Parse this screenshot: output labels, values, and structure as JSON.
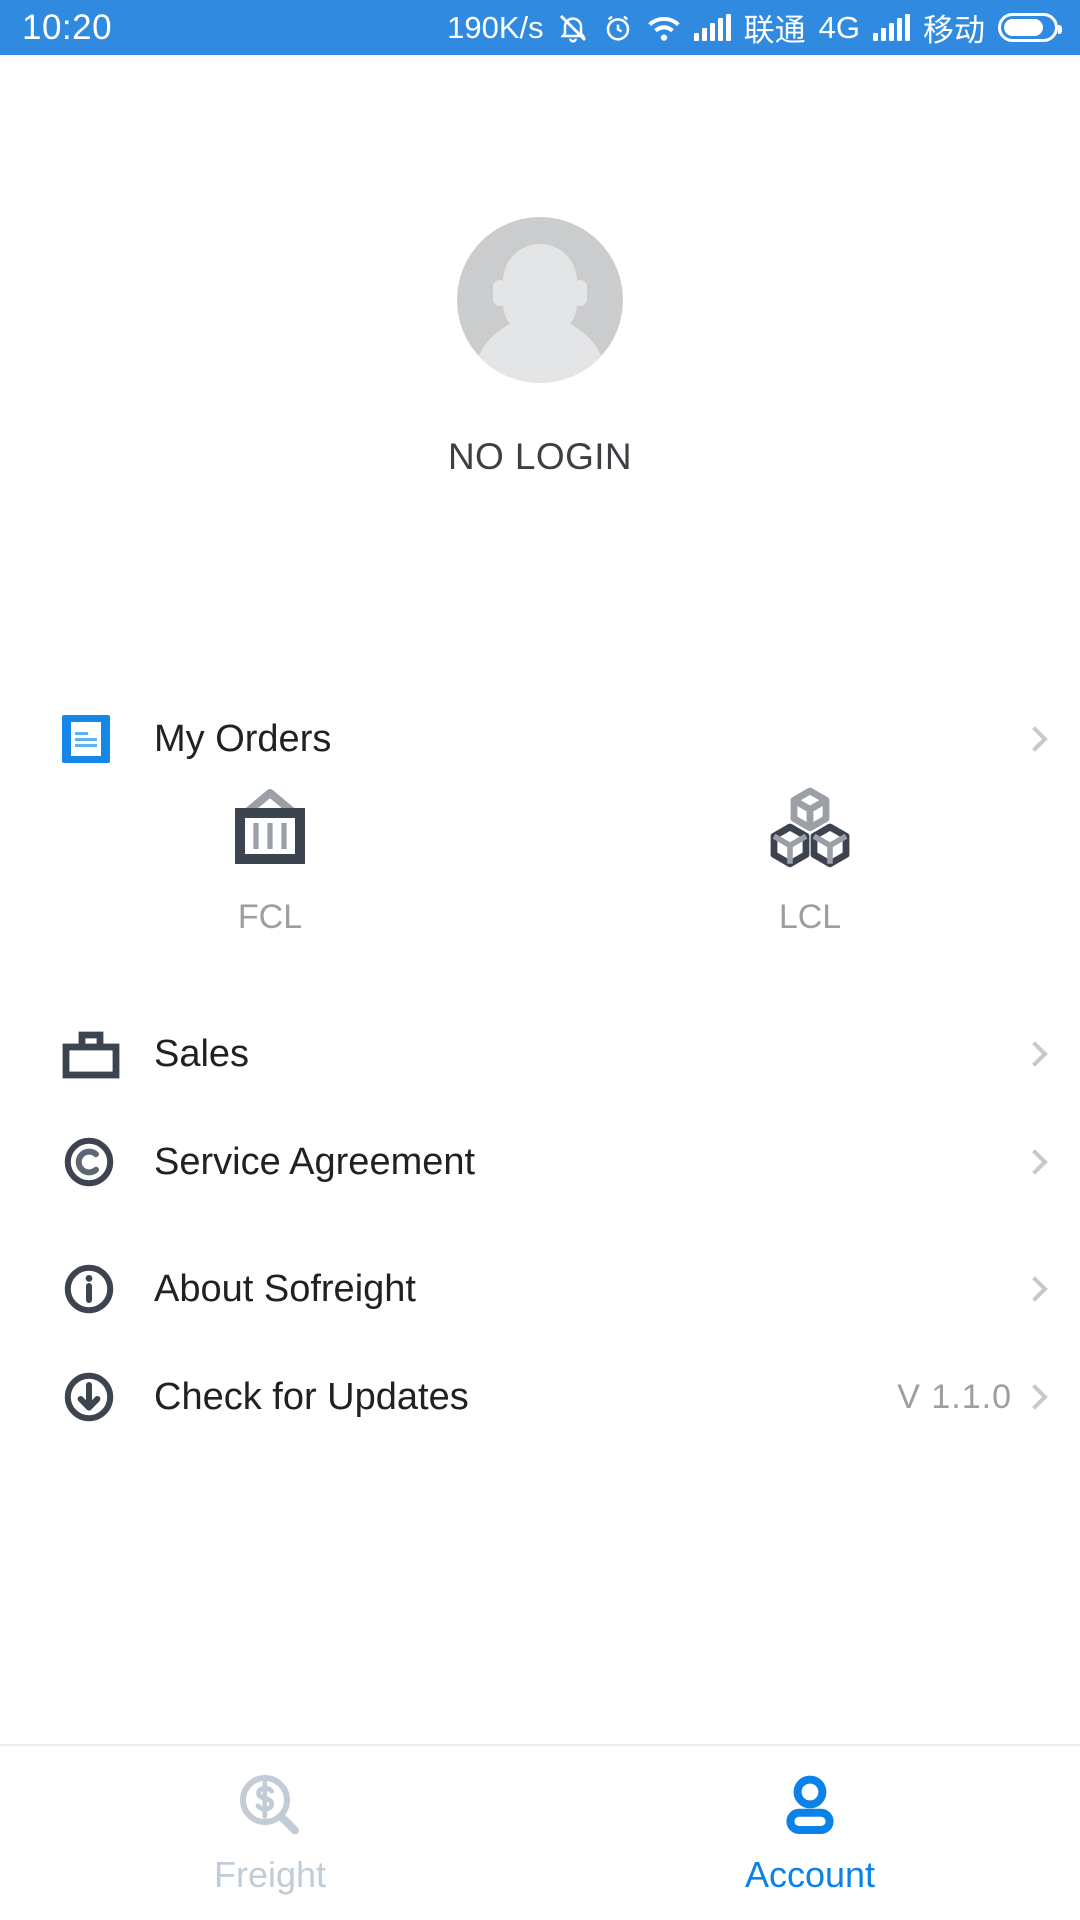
{
  "status_bar": {
    "time": "10:20",
    "net_speed": "190K/s",
    "carrier_1": "联通",
    "network_type": "4G",
    "carrier_2": "移动",
    "icons": [
      "mute-bell-icon",
      "alarm-clock-icon",
      "wifi-icon",
      "signal-bars-icon",
      "signal-bars-icon",
      "battery-icon"
    ],
    "background_color": "#2f8ae0"
  },
  "profile": {
    "avatar_icon": "default-user-avatar",
    "login_status": "NO LOGIN"
  },
  "menu": {
    "orders": {
      "label": "My Orders",
      "icon": "document-list-icon",
      "icon_color": "#1587e8"
    },
    "shipping_modes": [
      {
        "label": "FCL",
        "icon": "shipping-container-icon"
      },
      {
        "label": "LCL",
        "icon": "cubes-stack-icon"
      }
    ],
    "items": [
      {
        "label": "Sales",
        "icon": "briefcase-icon",
        "value": ""
      },
      {
        "label": "Service Agreement",
        "icon": "copyright-circle-icon",
        "value": ""
      },
      {
        "label": "About Sofreight",
        "icon": "info-circle-icon",
        "value": ""
      },
      {
        "label": "Check for Updates",
        "icon": "download-circle-icon",
        "value": "V 1.1.0"
      }
    ]
  },
  "tab_bar": {
    "tabs": [
      {
        "label": "Freight",
        "icon": "dollar-magnifier-icon",
        "active": false
      },
      {
        "label": "Account",
        "icon": "person-icon",
        "active": true
      }
    ],
    "active_color": "#0b82e8",
    "inactive_color": "#c2ccd6"
  }
}
